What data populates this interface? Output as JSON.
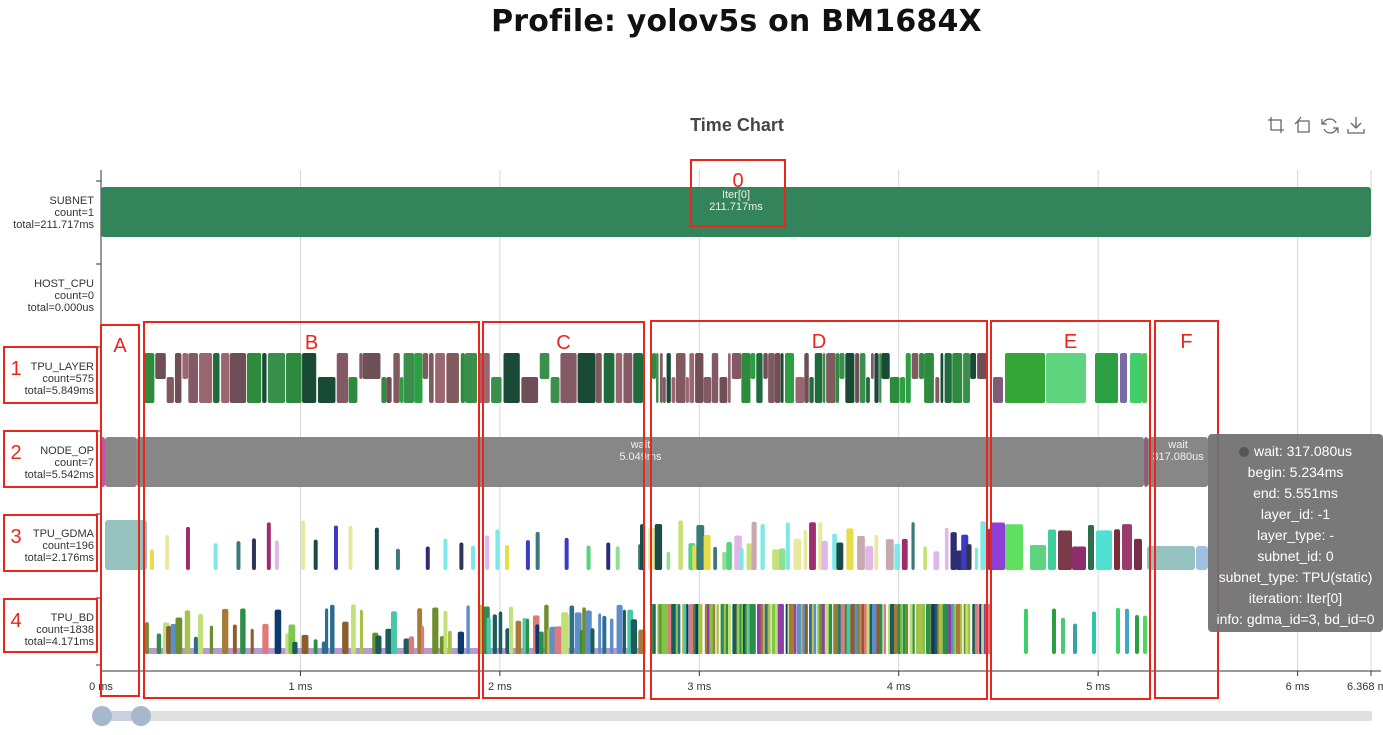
{
  "title": "Profile: yolov5s on BM1684X",
  "chart_data": {
    "type": "timeline",
    "title": "Time Chart",
    "x_unit": "ms",
    "xlim": [
      0,
      6.368
    ],
    "x_ticks": [
      {
        "value": 0,
        "label": "0 ms"
      },
      {
        "value": 1,
        "label": "1 ms"
      },
      {
        "value": 2,
        "label": "2 ms"
      },
      {
        "value": 3,
        "label": "3 ms"
      },
      {
        "value": 4,
        "label": "4 ms"
      },
      {
        "value": 5,
        "label": "5 ms"
      },
      {
        "value": 6,
        "label": "6 ms"
      },
      {
        "value": 6.368,
        "label": "6.368 ms"
      }
    ],
    "grid": true,
    "rows": [
      {
        "key": "subnet",
        "lines": [
          "SUBNET",
          "count=1",
          "total=211.717ms"
        ]
      },
      {
        "key": "host_cpu",
        "lines": [
          "HOST_CPU",
          "count=0",
          "total=0.000us"
        ]
      },
      {
        "key": "tpu_layer",
        "lines": [
          "TPU_LAYER",
          "count=575",
          "total=5.849ms"
        ]
      },
      {
        "key": "node_op",
        "lines": [
          "NODE_OP",
          "count=7",
          "total=5.542ms"
        ]
      },
      {
        "key": "tpu_gdma",
        "lines": [
          "TPU_GDMA",
          "count=196",
          "total=2.176ms"
        ]
      },
      {
        "key": "tpu_bd",
        "lines": [
          "TPU_BD",
          "count=1838",
          "total=4.171ms"
        ]
      }
    ],
    "labeled_bars": [
      {
        "row": "subnet",
        "start": 0,
        "end": 6.368,
        "color": "#33845a",
        "text": [
          "Iter[0]",
          "211.717ms"
        ]
      },
      {
        "row": "node_op",
        "start": 0.0,
        "end": 0.02,
        "color": "#c255a0",
        "text": []
      },
      {
        "row": "node_op",
        "start": 0.02,
        "end": 0.18,
        "color": "#878787",
        "text": []
      },
      {
        "row": "node_op",
        "start": 0.18,
        "end": 5.23,
        "color": "#878787",
        "text": [
          "wait",
          "5.049ms"
        ]
      },
      {
        "row": "node_op",
        "start": 5.23,
        "end": 5.25,
        "color": "#8e5d7a",
        "text": []
      },
      {
        "row": "node_op",
        "start": 5.25,
        "end": 5.551,
        "color": "#878787",
        "text": [
          "wait",
          "317.080us"
        ]
      }
    ],
    "tooltip": {
      "heading": "wait: 317.080us",
      "lines": [
        "begin: 5.234ms",
        "end: 5.551ms",
        "layer_id: -1",
        "layer_type: -",
        "subnet_id: 0",
        "subnet_type: TPU(static)",
        "iteration: Iter[0]",
        "info: gdma_id=3, bd_id=0"
      ]
    },
    "annotations": [
      {
        "label": "0",
        "kind": "region"
      },
      {
        "label": "A",
        "kind": "region"
      },
      {
        "label": "B",
        "kind": "region"
      },
      {
        "label": "C",
        "kind": "region"
      },
      {
        "label": "D",
        "kind": "region"
      },
      {
        "label": "E",
        "kind": "region"
      },
      {
        "label": "F",
        "kind": "region"
      },
      {
        "label": "1",
        "kind": "row"
      },
      {
        "label": "2",
        "kind": "row"
      },
      {
        "label": "3",
        "kind": "row"
      },
      {
        "label": "4",
        "kind": "row"
      }
    ],
    "zoom_slider": {
      "start": 0,
      "end": 1
    }
  },
  "toolbox": [
    "zoom-icon",
    "zoom-reset-icon",
    "restore-icon",
    "save-image-icon"
  ],
  "colors": {
    "annotation": "#e8261c",
    "subnet": "#33845a",
    "wait": "#878787"
  }
}
